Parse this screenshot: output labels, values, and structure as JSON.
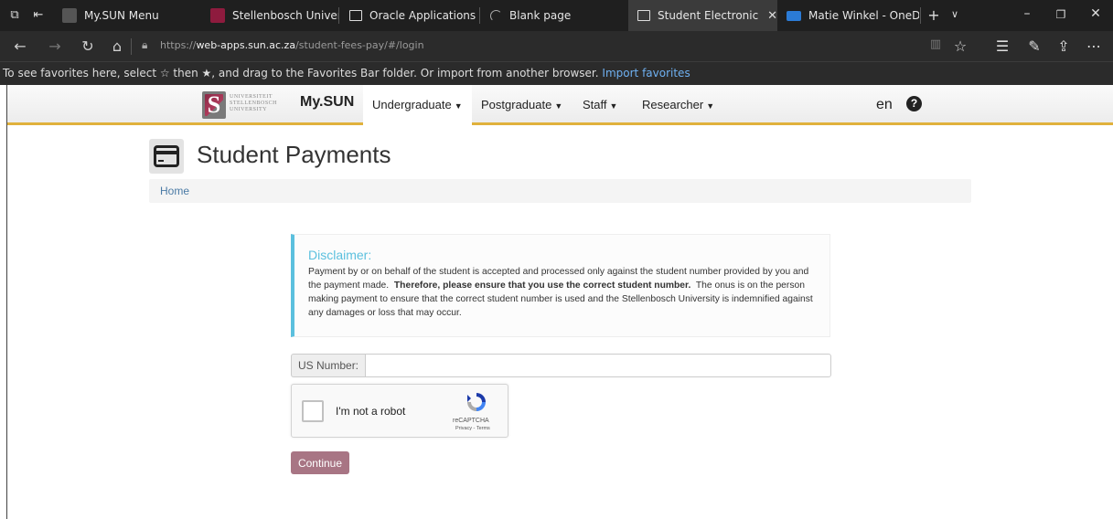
{
  "browser": {
    "tabs": [
      {
        "title": "My.SUN Menu",
        "active": false
      },
      {
        "title": "Stellenbosch University - Se",
        "active": false
      },
      {
        "title": "Oracle Applications",
        "active": false
      },
      {
        "title": "Blank page",
        "active": false
      },
      {
        "title": "Student Electronic Paym",
        "active": true
      },
      {
        "title": "Matie Winkel - OneDrive",
        "active": false
      }
    ],
    "url_prefix": "https://",
    "url_host": "web-apps.sun.ac.za",
    "url_path": "/student-fees-pay/#/login",
    "favorites_prompt": "To see favorites here, select ☆ then ★, and drag to the Favorites Bar folder. Or import from another browser.",
    "import_favorites": "Import favorites"
  },
  "site_nav": {
    "logo_text": "UNIVERSITEIT STELLENBOSCH UNIVERSITY",
    "brand": "My.SUN",
    "items": [
      {
        "label": "Undergraduate",
        "active": true
      },
      {
        "label": "Postgraduate",
        "active": false
      },
      {
        "label": "Staff",
        "active": false
      },
      {
        "label": "Researcher",
        "active": false
      }
    ],
    "language": "en",
    "help": "?"
  },
  "page": {
    "title": "Student Payments",
    "breadcrumb": "Home"
  },
  "disclaimer": {
    "title": "Disclaimer:",
    "text_1": "Payment by or on behalf of the student is accepted and processed only against the student number provided by you and the payment made.",
    "text_bold": "Therefore, please ensure that you use the correct student number.",
    "text_2": "The onus is on the person making payment to ensure that the correct student number is used and the Stellenbosch University is indemnified against any damages or loss that may occur."
  },
  "form": {
    "us_number_label": "US Number:",
    "us_number_value": "",
    "recaptcha_label": "I'm not a robot",
    "recaptcha_brand": "reCAPTCHA",
    "recaptcha_links": "Privacy - Terms",
    "continue_label": "Continue"
  },
  "colors": {
    "accent_gold": "#e0b13c",
    "disclaimer_blue": "#5bc0de",
    "continue_button": "#a87584"
  }
}
